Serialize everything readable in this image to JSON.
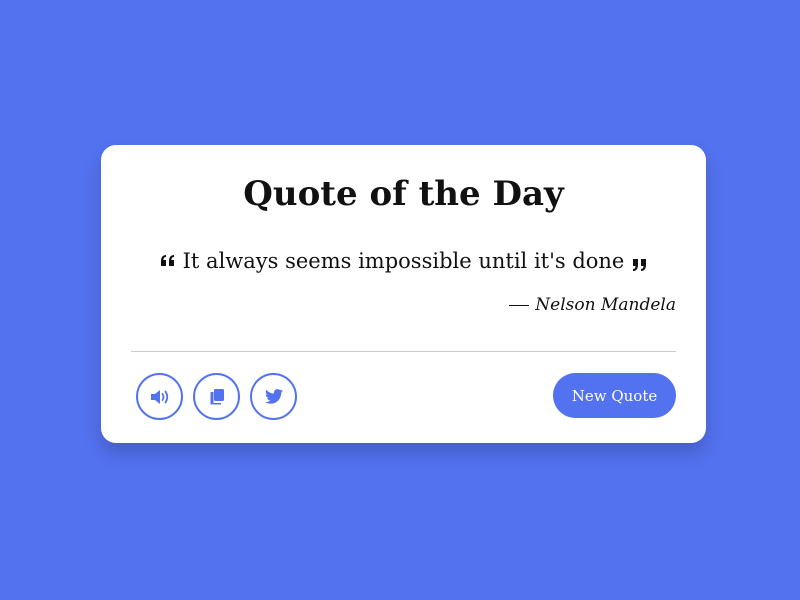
{
  "card": {
    "title": "Quote of the Day",
    "quote": "It always seems impossible until it's done",
    "author": "Nelson Mandela"
  },
  "actions": {
    "speak_icon": "volume-icon",
    "copy_icon": "copy-icon",
    "tweet_icon": "twitter-icon",
    "new_quote_label": "New Quote"
  },
  "colors": {
    "background": "#5372f0",
    "accent": "#5372f0",
    "card": "#ffffff"
  }
}
